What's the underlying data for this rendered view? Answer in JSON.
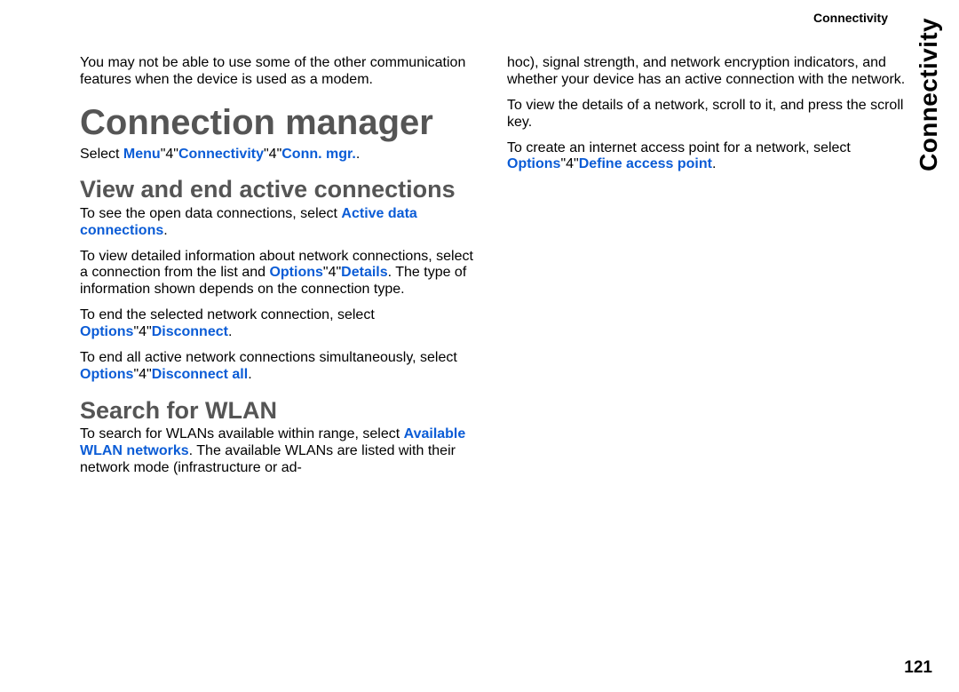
{
  "runningHead": "Connectivity",
  "sideTab": "Connectivity",
  "pageNumber": "121",
  "intro_pre": "You may not be able to use some of the other communication features when the device is used as a modem.",
  "h1": "Connection manager",
  "nav": {
    "select": "Select ",
    "menu": "Menu",
    "sep": "\"4\"",
    "connectivity": "Connectivity",
    "connmgr": "Conn. mgr.",
    "period": "."
  },
  "h2_view": "View and end active connections",
  "para_active_pre": "To see the open data connections, select ",
  "kw_active_data": "Active data connections",
  "period": ".",
  "para_details1": "To view detailed information about network connections, select a connection from the list and ",
  "kw_options1": "Options",
  "kw_details": "Details",
  "para_details2": ". The type of information shown depends on the connection type.",
  "para_end1": "To end the selected network connection, select ",
  "kw_options2": "Options",
  "kw_disconnect": "Disconnect",
  "para_endall1": "To end all active network connections simultaneously, select ",
  "kw_options3": "Options",
  "kw_disconnect_all": "Disconnect all",
  "h2_wlan": "Search for WLAN",
  "wlan1_pre": "To search for WLANs available within range, select ",
  "kw_avail_wlan": "Available WLAN networks",
  "wlan1_post": ". The available WLANs are listed with their network mode (infrastructure or ad-",
  "col2_p1": "hoc), signal strength, and network encryption indicators, and whether your device has an active connection with the network.",
  "col2_p2": "To view the details of a network, scroll to it, and press the scroll key.",
  "col2_p3_pre": "To create an internet access point for a network, select ",
  "kw_options4": "Options",
  "kw_define_ap": "Define access point"
}
